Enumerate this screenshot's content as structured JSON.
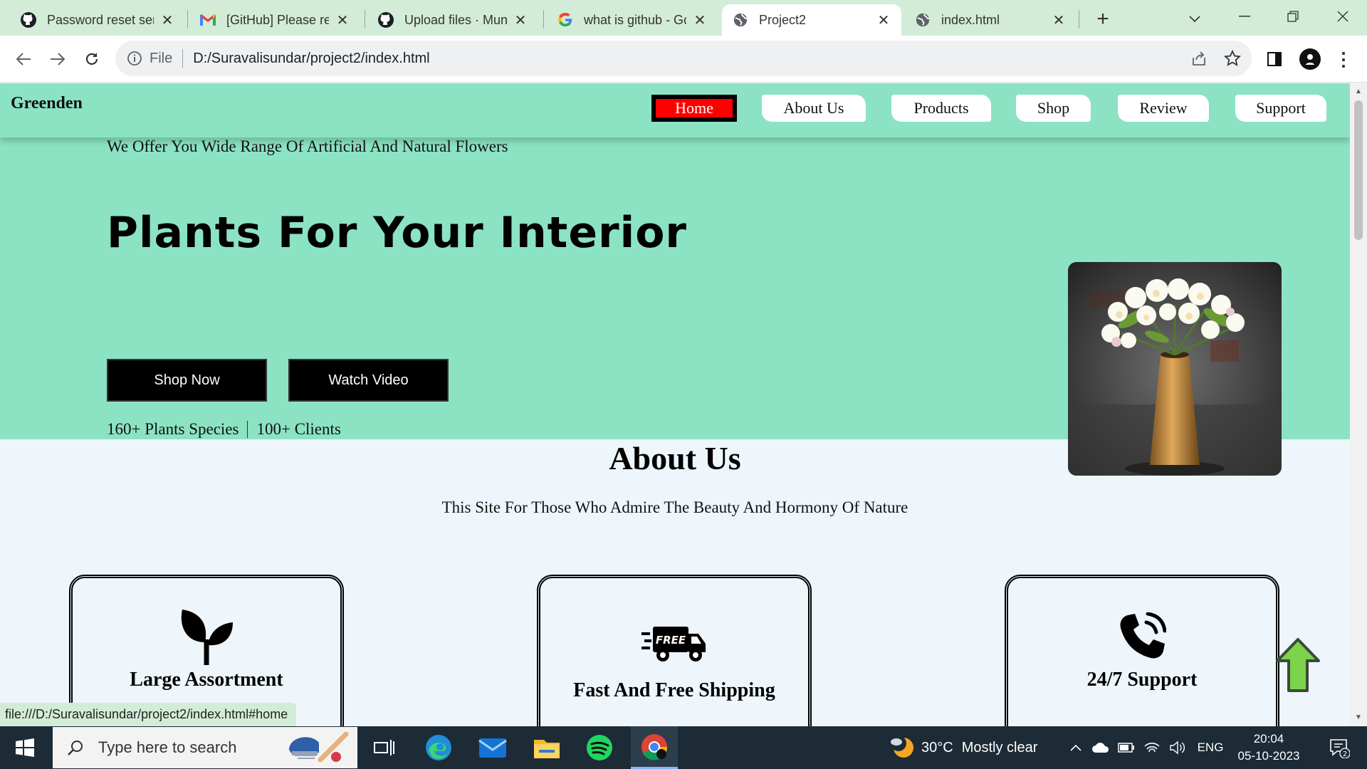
{
  "browser": {
    "tabs": [
      {
        "title": "Password reset ser",
        "icon": "github-icon"
      },
      {
        "title": "[GitHub] Please re",
        "icon": "gmail-icon"
      },
      {
        "title": "Upload files · Mun",
        "icon": "github-icon"
      },
      {
        "title": "what is github - Go",
        "icon": "google-icon"
      },
      {
        "title": "Project2",
        "icon": "globe-icon",
        "active": true
      },
      {
        "title": "index.html",
        "icon": "globe-icon"
      }
    ],
    "address": {
      "scheme": "File",
      "url": "D:/Suravalisundar/project2/index.html"
    },
    "status_link": "file:///D:/Suravalisundar/project2/index.html#home"
  },
  "site": {
    "logo": "Greenden",
    "nav": [
      {
        "label": "Home",
        "active": true
      },
      {
        "label": "About Us"
      },
      {
        "label": "Products"
      },
      {
        "label": "Shop"
      },
      {
        "label": "Review"
      },
      {
        "label": "Support"
      }
    ],
    "hero": {
      "tagline": "We Offer You Wide Range Of Artificial And Natural Flowers",
      "title": "Plants For Your Interior",
      "buttons": {
        "shop": "Shop Now",
        "video": "Watch Video"
      },
      "stats": {
        "species": "160+ Plants Species",
        "clients": "100+ Clients"
      }
    },
    "about": {
      "title": "About Us",
      "subtitle": "This Site For Those Who Admire The Beauty And Hormony Of Nature",
      "features": [
        {
          "title": "Large Assortment",
          "icon": "sprout-icon"
        },
        {
          "title": "Fast And Free Shipping",
          "icon": "free-delivery-truck-icon",
          "badge": "FREE"
        },
        {
          "title": "24/7 Support",
          "icon": "phone-icon"
        }
      ]
    }
  },
  "taskbar": {
    "search_placeholder": "Type here to search",
    "weather": {
      "temp": "30°C",
      "condition": "Mostly clear"
    },
    "language": "ENG",
    "time": "20:04",
    "date": "05-10-2023",
    "notifications": "2"
  },
  "colors": {
    "hero_bg": "#8be3c3",
    "nav_active": "#ff0000",
    "tab_strip": "#d3ecd8",
    "scroll_top_arrow": "#7bd44a"
  }
}
